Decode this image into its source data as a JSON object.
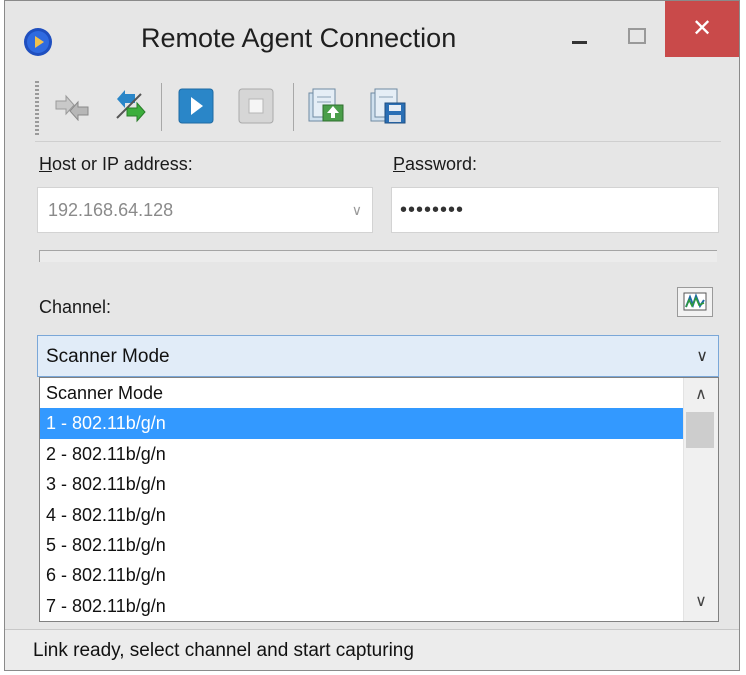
{
  "window": {
    "title": "Remote Agent Connection",
    "close_label": "✕"
  },
  "toolbar": {
    "buttons": [
      {
        "name": "connect",
        "icon": "connect-arrows-icon"
      },
      {
        "name": "reconnect",
        "icon": "reconnect-arrows-icon"
      },
      {
        "name": "start-capture",
        "icon": "play-icon"
      },
      {
        "name": "stop-capture",
        "icon": "stop-icon"
      },
      {
        "name": "open-config",
        "icon": "open-config-icon"
      },
      {
        "name": "save-config",
        "icon": "save-config-icon"
      }
    ]
  },
  "form": {
    "host_label_u": "H",
    "host_label_rest": "ost or IP address:",
    "host_value": "192.168.64.128",
    "password_label_u": "P",
    "password_label_rest": "assword:",
    "password_value": "••••••••",
    "progress": 0,
    "channel_label": "Channel:",
    "channel_selected": "Scanner Mode"
  },
  "dropdown": {
    "options": [
      "Scanner Mode",
      "1 - 802.11b/g/n",
      "2 - 802.11b/g/n",
      "3 - 802.11b/g/n",
      "4 - 802.11b/g/n",
      "5 - 802.11b/g/n",
      "6 - 802.11b/g/n",
      "7 - 802.11b/g/n"
    ],
    "highlighted_index": 1
  },
  "status": {
    "text": "Link ready, select channel and start capturing"
  },
  "colors": {
    "highlight": "#3399ff",
    "close": "#c94a4a",
    "play": "#2a86c8"
  }
}
